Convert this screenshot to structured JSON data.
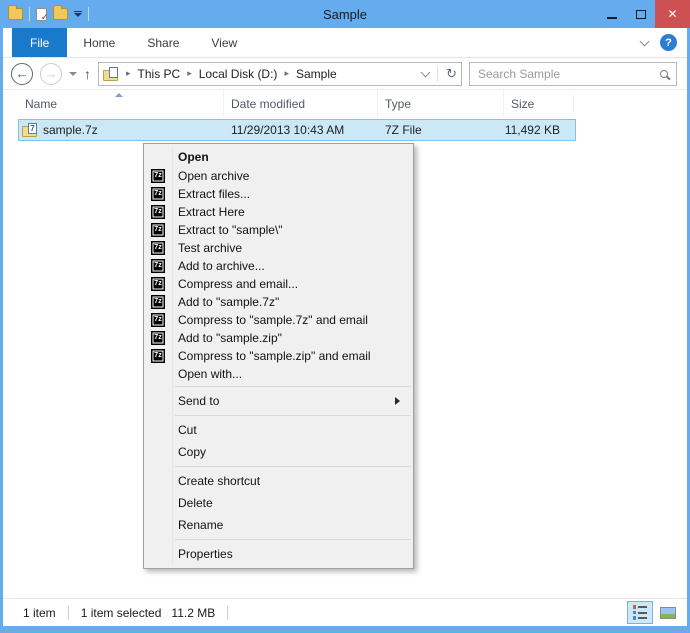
{
  "window": {
    "title": "Sample"
  },
  "colors": {
    "titlebar_blue": "#65ACEF",
    "file_tab_blue": "#1979CA",
    "close_red": "#CD5152",
    "selection_bg": "#CBE8F6",
    "selection_border": "#84C1E8",
    "menu_bg": "#F0F0F0"
  },
  "icons": {
    "seven_zip_glyph": "7z",
    "file_7z_glyph": "7",
    "back_arrow": "←",
    "forward_arrow": "→",
    "up_arrow": "↑",
    "refresh": "↻",
    "help": "?",
    "close": "✕",
    "crumb_sep": "▸",
    "doc_check": "✓"
  },
  "ribbon": {
    "tabs": [
      {
        "label": "File"
      },
      {
        "label": "Home"
      },
      {
        "label": "Share"
      },
      {
        "label": "View"
      }
    ]
  },
  "nav": {
    "breadcrumb": [
      "This PC",
      "Local Disk (D:)",
      "Sample"
    ],
    "search_placeholder": "Search Sample"
  },
  "columns": [
    "Name",
    "Date modified",
    "Type",
    "Size"
  ],
  "file": {
    "name": "sample.7z",
    "date_modified": "11/29/2013 10:43 AM",
    "type": "7Z File",
    "size": "11,492 KB"
  },
  "context_menu": {
    "groups": [
      {
        "items": [
          {
            "label": "Open",
            "bold": true
          },
          {
            "label": "Open archive",
            "icon": "7z"
          },
          {
            "label": "Extract files...",
            "icon": "7z"
          },
          {
            "label": "Extract Here",
            "icon": "7z"
          },
          {
            "label": "Extract to \"sample\\\"",
            "icon": "7z"
          },
          {
            "label": "Test archive",
            "icon": "7z"
          },
          {
            "label": "Add to archive...",
            "icon": "7z"
          },
          {
            "label": "Compress and email...",
            "icon": "7z"
          },
          {
            "label": "Add to \"sample.7z\"",
            "icon": "7z"
          },
          {
            "label": "Compress to \"sample.7z\" and email",
            "icon": "7z"
          },
          {
            "label": "Add to \"sample.zip\"",
            "icon": "7z"
          },
          {
            "label": "Compress to \"sample.zip\" and email",
            "icon": "7z"
          },
          {
            "label": "Open with..."
          }
        ]
      },
      {
        "items": [
          {
            "label": "Send to",
            "submenu": true
          }
        ]
      },
      {
        "items": [
          {
            "label": "Cut"
          },
          {
            "label": "Copy"
          }
        ]
      },
      {
        "items": [
          {
            "label": "Create shortcut"
          },
          {
            "label": "Delete"
          },
          {
            "label": "Rename"
          }
        ]
      },
      {
        "items": [
          {
            "label": "Properties"
          }
        ]
      }
    ]
  },
  "status_bar": {
    "items_count": "1 item",
    "selected_count": "1 item selected",
    "selected_size": "11.2 MB"
  }
}
